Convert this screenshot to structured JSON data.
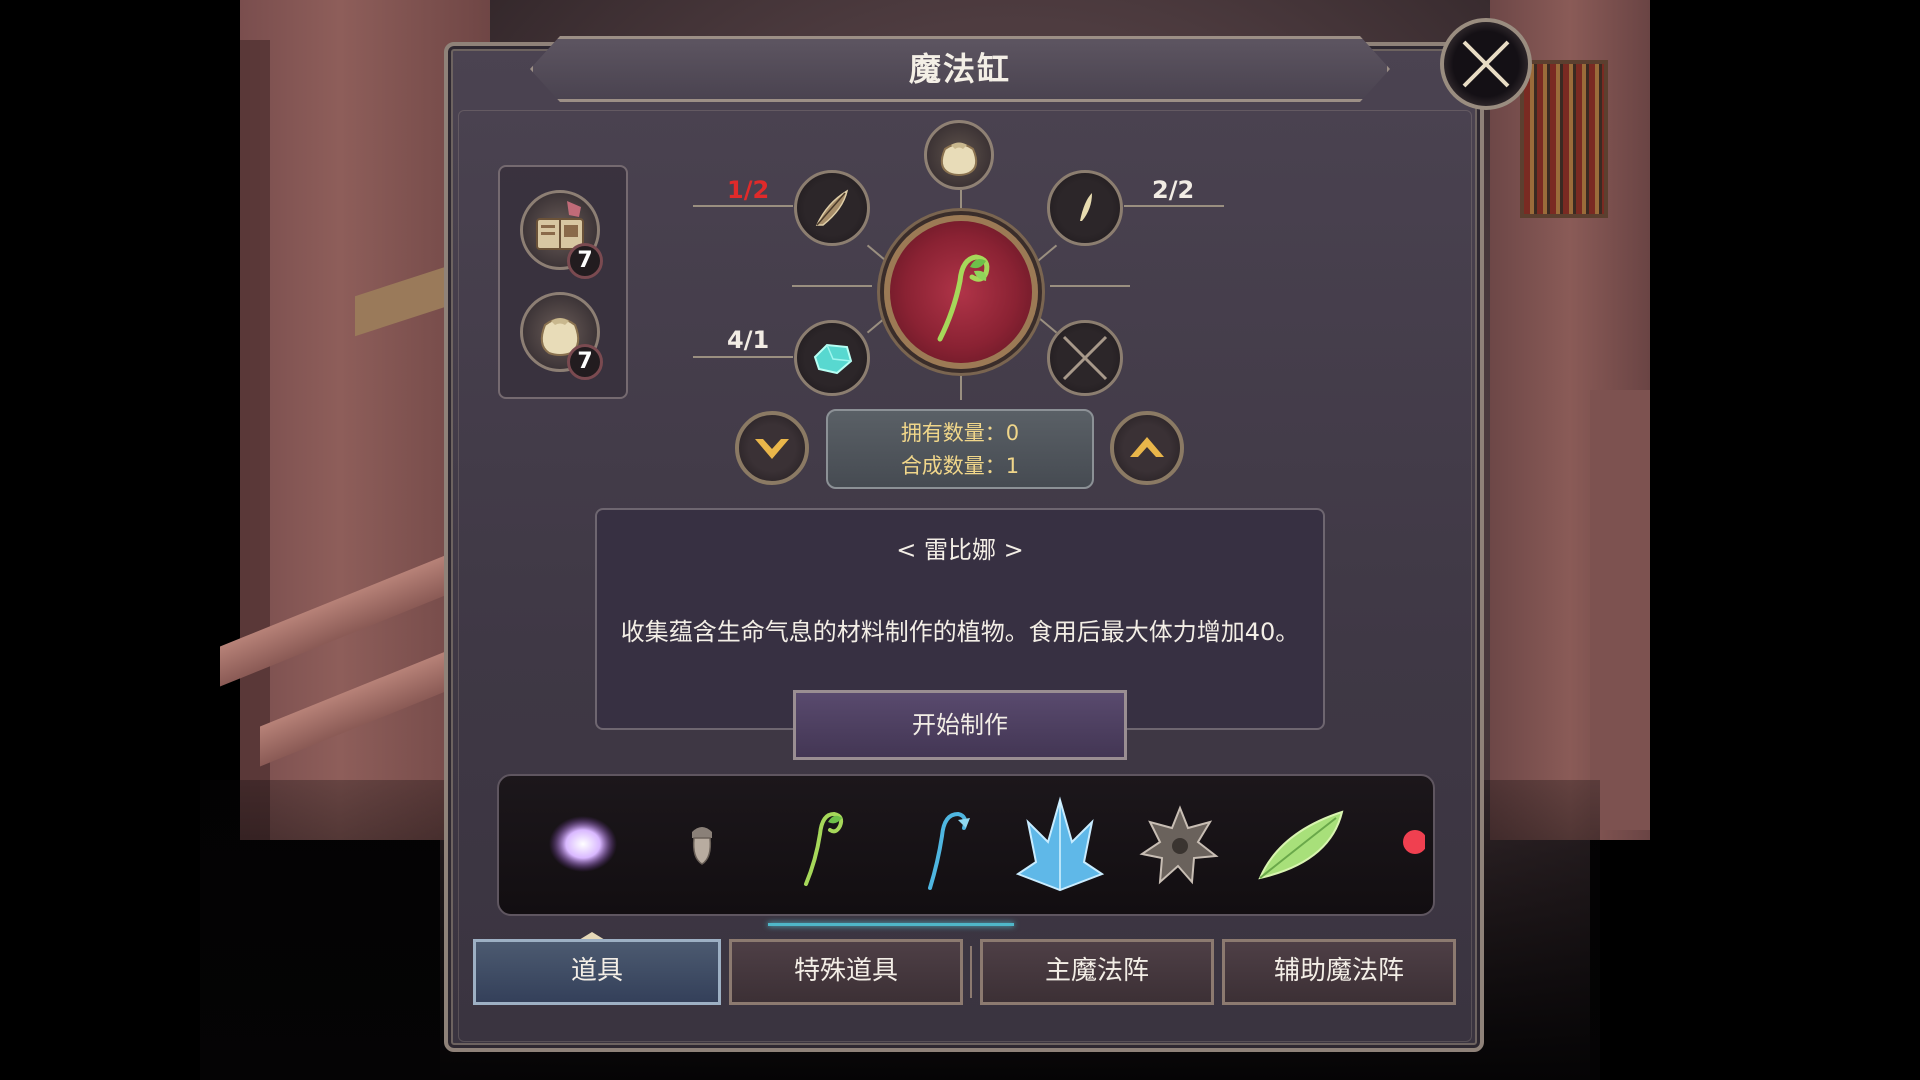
{
  "window": {
    "title": "魔法缸"
  },
  "inventory": [
    {
      "icon": "spellbook-icon",
      "count": "7"
    },
    {
      "icon": "sack-icon",
      "count": "7"
    }
  ],
  "recipe": {
    "top_slot_icon": "sack-icon",
    "result_icon": "sprout-icon",
    "ingredients": [
      {
        "position": "top-left",
        "icon": "feather-icon",
        "count": "1/2",
        "insufficient": true
      },
      {
        "position": "top-right",
        "icon": "leaf-icon",
        "count": "2/2",
        "insufficient": false
      },
      {
        "position": "bottom-left",
        "icon": "crystal-gem-icon",
        "count": "4/1",
        "insufficient": false
      },
      {
        "position": "bottom-right",
        "icon": "empty-slot-icon",
        "count": "",
        "insufficient": false
      }
    ],
    "owned_label": "拥有数量：0",
    "craft_qty_label": "合成数量：1"
  },
  "description": {
    "name": "< 雷比娜 >",
    "text": "收集蕴含生命气息的材料制作的植物。食用后最大体力增加40。"
  },
  "craft_button": "开始制作",
  "items_strip": [
    "glowing-orb-icon",
    "acorn-icon",
    "sprout-icon",
    "blue-hook-plant-icon",
    "ice-crystal-icon",
    "spiky-ore-icon",
    "green-leaf-icon",
    "red-orb-icon"
  ],
  "tabs": [
    {
      "label": "道具",
      "active": true
    },
    {
      "label": "特殊道具",
      "active": false
    },
    {
      "label": "主魔法阵",
      "active": false
    },
    {
      "label": "辅助魔法阵",
      "active": false
    }
  ],
  "colors": {
    "accent_red": "#e02a2a",
    "quantity_text": "#f0d68a",
    "active_tab": "#34405a",
    "result_circle": "#8a2233"
  }
}
